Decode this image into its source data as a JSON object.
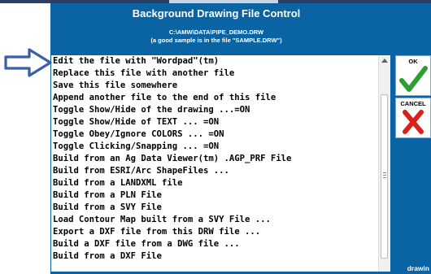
{
  "window": {
    "title": "Background Drawing File Control",
    "file_path": "C:\\AMW\\DATA\\PIPE_DEMO.DRW",
    "hint": "(a good sample is in the file \"SAMPLE.DRW\")"
  },
  "list": {
    "items": [
      "Edit the file with \"Wordpad\"(tm)",
      "Replace this file with another file",
      "Save this file somewhere",
      "Append another file to the end of this file",
      "Toggle Show/Hide of the drawing ...=ON",
      "Toggle Show/Hide of TEXT ... =ON",
      "Toggle Obey/Ignore COLORS ... =ON",
      "Toggle Clicking/Snapping ... =ON",
      "Build from an Ag Data Viewer(tm) .AGP_PRF File",
      "Build from ESRI/Arc ShapeFiles ...",
      "Build from a LANDXML file",
      "Build from a PLN File",
      "Build from a SVY File",
      "Load Contour Map built from a SVY File ...",
      "Export a DXF file from this DRW file ...",
      "Build a DXF file from a DWG file ...",
      "Build from a DXF File"
    ]
  },
  "buttons": {
    "ok_label": "OK",
    "cancel_label": "CANCEL"
  },
  "footer": {
    "corner_text": "drawin"
  },
  "icons": {
    "pointer": "blue-arrow-icon",
    "ok": "green-checkmark-icon",
    "cancel": "red-x-icon"
  },
  "colors": {
    "panel": "#0a64a4",
    "check": "#2e9e2e",
    "cancel_x": "#d8211b",
    "arrow": "#3a5ea8"
  }
}
